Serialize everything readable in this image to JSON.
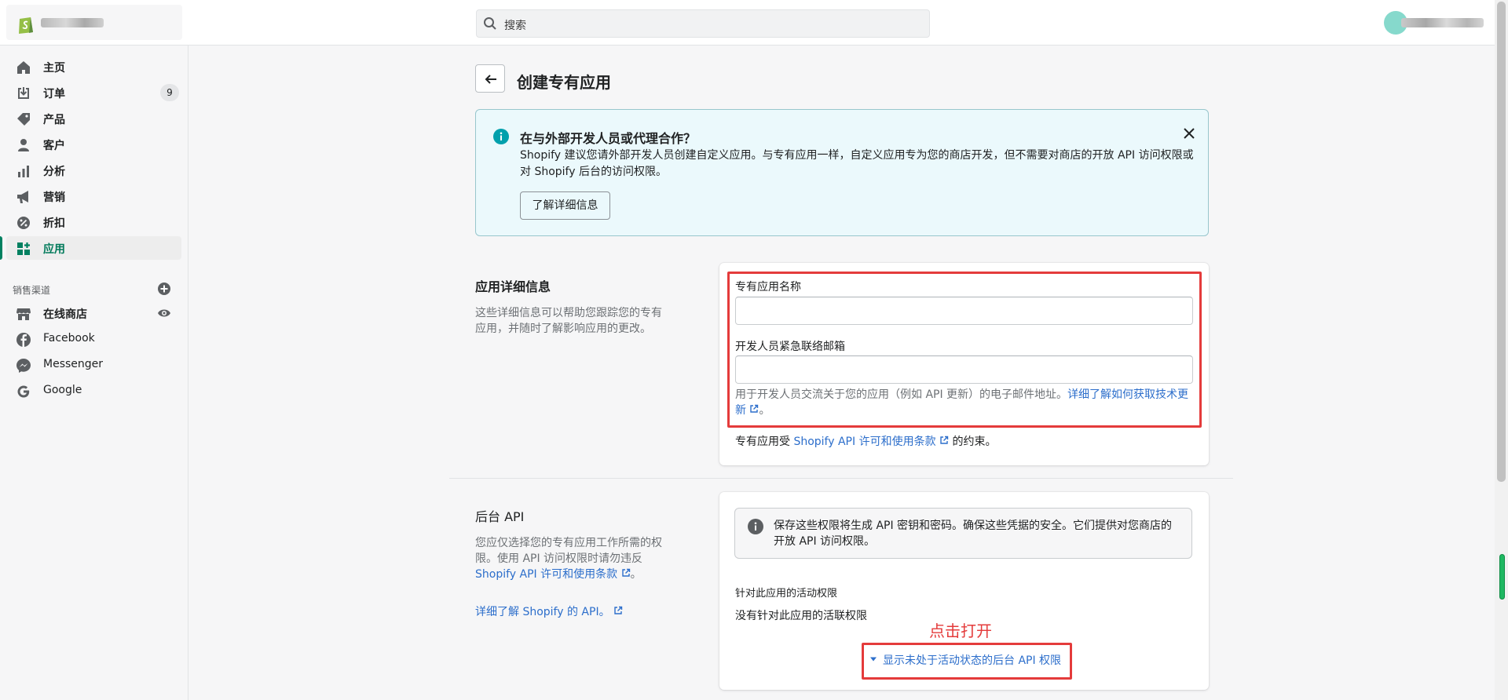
{
  "topbar": {
    "search_placeholder": "搜索"
  },
  "sidebar": {
    "items": [
      {
        "label": "主页"
      },
      {
        "label": "订单",
        "badge": "9"
      },
      {
        "label": "产品"
      },
      {
        "label": "客户"
      },
      {
        "label": "分析"
      },
      {
        "label": "营销"
      },
      {
        "label": "折扣"
      },
      {
        "label": "应用"
      }
    ],
    "channels_heading": "销售渠道",
    "channels": [
      {
        "label": "在线商店"
      },
      {
        "label": "Facebook"
      },
      {
        "label": "Messenger"
      },
      {
        "label": "Google"
      }
    ]
  },
  "page": {
    "title": "创建专有应用"
  },
  "banner": {
    "title": "在与外部开发人员或代理合作？",
    "body": "Shopify 建议您请外部开发人员创建自定义应用。与专有应用一样，自定义应用专为您的商店开发，但不需要对商店的开放 API 访问权限或对 Shopify 后台的访问权限。",
    "button": "了解详细信息"
  },
  "app_details": {
    "title": "应用详细信息",
    "description": "这些详细信息可以帮助您跟踪您的专有应用，并随时了解影响应用的更改。",
    "name_label": "专有应用名称",
    "name_value": "",
    "email_label": "开发人员紧急联络邮箱",
    "email_value": "",
    "help_text": "用于开发人员交流关于您的应用（例如 API 更新）的电子邮件地址。",
    "help_link": "详细了解如何获取技术更新",
    "terms_prefix": "专有应用受 ",
    "terms_link": "Shopify API 许可和使用条款",
    "terms_suffix": " 的约束。"
  },
  "admin_api": {
    "title": "后台 API",
    "description": "您应仅选择您的专有应用工作所需的权限。使用 API 访问权限时请勿违反",
    "desc_link": "Shopify API 许可和使用条款",
    "desc_suffix": "。",
    "learn_link": "详细了解 Shopify 的 API。",
    "note": "保存这些权限将生成 API 密钥和密码。确保这些凭据的安全。它们提供对您商店的开放 API 访问权限。",
    "active_heading": "针对此应用的活动权限",
    "no_active": "没有针对此应用的活联权限",
    "annotation": "点击打开",
    "show_inactive": "显示未处于活动状态的后台 API 权限"
  },
  "colors": {
    "accent": "#008060",
    "link": "#2c6ecb",
    "annotation_red": "#e43b3b",
    "banner_bg": "#ebf9fc"
  }
}
